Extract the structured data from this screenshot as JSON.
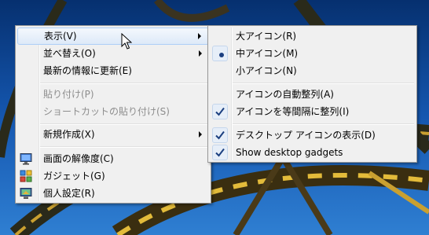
{
  "context_menu": {
    "items": [
      {
        "label": "表示(V)",
        "submenu": true
      },
      {
        "label": "並べ替え(O)",
        "submenu": true
      },
      {
        "label": "最新の情報に更新(E)"
      },
      {
        "label": "貼り付け(P)",
        "disabled": true
      },
      {
        "label": "ショートカットの貼り付け(S)",
        "disabled": true
      },
      {
        "label": "新規作成(X)",
        "submenu": true
      },
      {
        "label": "画面の解像度(C)",
        "icon": "monitor-icon"
      },
      {
        "label": "ガジェット(G)",
        "icon": "gadgets-icon"
      },
      {
        "label": "個人設定(R)",
        "icon": "personalize-icon"
      }
    ]
  },
  "view_submenu": {
    "items": [
      {
        "label": "大アイコン(R)"
      },
      {
        "label": "中アイコン(M)",
        "selected": true
      },
      {
        "label": "小アイコン(N)"
      },
      {
        "label": "アイコンの自動整列(A)"
      },
      {
        "label": "アイコンを等間隔に整列(I)",
        "checked": true
      },
      {
        "label": "デスクトップ アイコンの表示(D)",
        "checked": true
      },
      {
        "label": "Show desktop gadgets",
        "checked": true
      }
    ]
  },
  "colors": {
    "desktop": "#0a3f8a",
    "menu_bg": "#f0f0f0",
    "highlight": "#dde9f8",
    "check": "#1b3f80"
  }
}
